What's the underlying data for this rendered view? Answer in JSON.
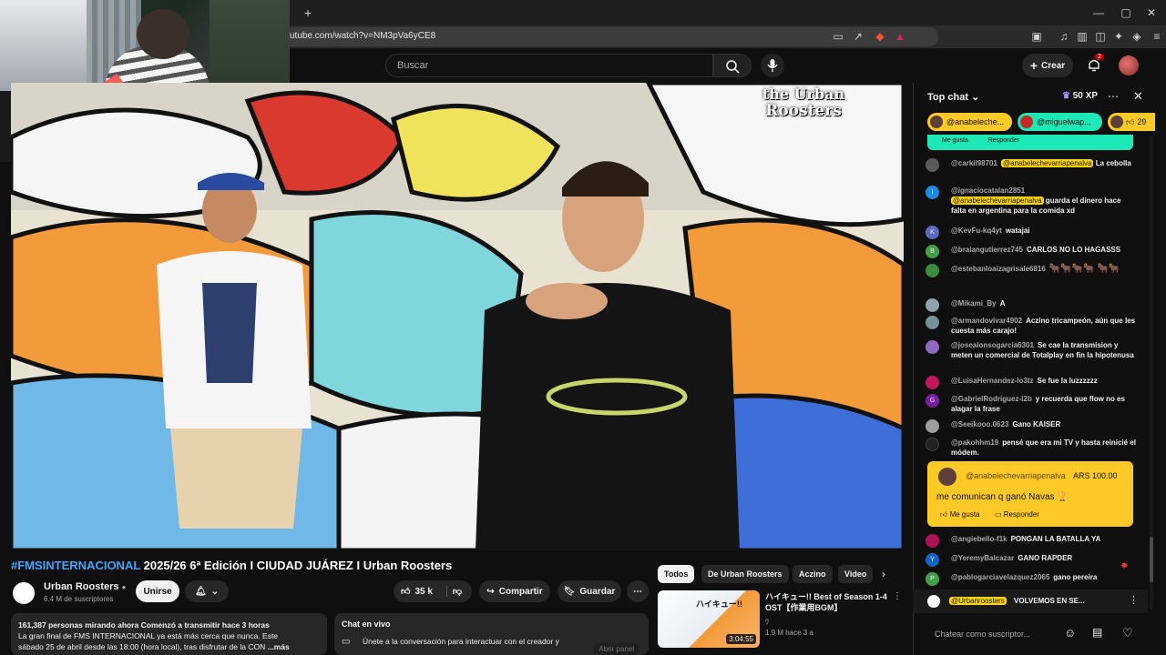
{
  "browser": {
    "url": "utube.com/watch?v=NM3pVa6yCE8",
    "new_tab": "+",
    "window_controls": [
      "minimize-icon",
      "maximize-icon",
      "close-icon"
    ]
  },
  "header": {
    "search_placeholder": "Buscar",
    "create_label": "Crear",
    "notif_count": "2"
  },
  "video": {
    "watermark_line1": "the Urban",
    "watermark_line2": "Roosters",
    "hashtag": "#FMSINTERNACIONAL",
    "title_rest": " 2025/26 6ª Edición I CIUDAD JUÁREZ I Urban Roosters"
  },
  "channel": {
    "name": "Urban Roosters",
    "subs": "6.4 M de suscriptores",
    "join": "Unirse"
  },
  "actions": {
    "likes": "35 k",
    "share": "Compartir",
    "save": "Guardar"
  },
  "description": {
    "line1": "161,387 personas mirando ahora  Comenzó a transmitir hace 3 horas",
    "line2": "La gran final de FMS INTERNACIONAL ya está más cerca que nunca. Este",
    "line3": "sábado 25 de abril desde las 18:00 (hora local), tras disfrutar de la CON",
    "more": "...más"
  },
  "live_chat_card": {
    "title": "Chat en vivo",
    "text": "Únete a la conversación para interactuar con el creador y",
    "button": "Abrir panel"
  },
  "recs": {
    "chips": [
      "Todos",
      "De Urban Roosters",
      "Aczino",
      "Video"
    ],
    "item": {
      "title_line1": "ハイキュー!! Best of Season 1-4",
      "title_line2": "OST【作業用BGM】",
      "channel": "ｳ",
      "meta": "1.9 M   hace 3 a",
      "duration": "3:04:55",
      "thumb_text": "ハイキュー!!"
    }
  },
  "chat": {
    "header": "Top chat",
    "xp": "50 XP",
    "pinned": [
      {
        "name": "@anabeleche..."
      },
      {
        "name": "@miguelwap..."
      },
      {
        "name": "29"
      }
    ],
    "top_actions": {
      "like": "Me gusta",
      "reply": "Responder"
    },
    "messages": [
      {
        "author": "@carkil98701",
        "mention": "@anabelechevarriapenalva",
        "text": "La cebolla",
        "color": "#5b5b5b"
      },
      {
        "author": "@ignaciocatalan2851",
        "mention": "@anabelechevarriapenalva",
        "text": "guarda el dinero hace falta en argentina para la comida xd",
        "color": "#1e88e5",
        "initial": "I"
      },
      {
        "author": "@KevFu-kq4yt",
        "text": "watajai",
        "color": "#5c6bc0",
        "initial": "K"
      },
      {
        "author": "@braiangutierrez745",
        "text": "CARLOS NO LO HAGASSS",
        "color": "#43a047",
        "initial": "B"
      },
      {
        "author": "@estebanloaizagrisale6816",
        "text": "🐂🐂🐂🐂 🐂🐂",
        "color": "#388e3c"
      },
      {
        "author": "@Mikami_By",
        "text": "A",
        "color": "#90a4ae"
      },
      {
        "author": "@armandovivar4902",
        "text": "Aczino tricampeón, aún que les cuesta más carajo!",
        "color": "#78909c"
      },
      {
        "author": "@josealonsogarcia6301",
        "text": "Se cae la transmision y meten un comercial de Totalplay en fin la hipotenusa",
        "color": "#8e6bbf"
      },
      {
        "author": "@LuisaHernandez-lo3tz",
        "text": "Se fue la luzzzzzz",
        "color": "#c2185b"
      },
      {
        "author": "@GabrielRodriguez-l2b",
        "text": "y recuerda que flow no es alagar la frase",
        "color": "#7b1fa2",
        "initial": "G"
      },
      {
        "author": "@Seeikooo.0623",
        "text": "Gano KAISER",
        "color": "#9e9e9e"
      },
      {
        "author": "@pakohhm19",
        "text": "pensé que era mi TV y hasta reinicié el módem.",
        "color": "#212121"
      }
    ],
    "superchat": {
      "author": "@anabelechevarriapenalva",
      "amount": "ARS 100.00",
      "text": "me comunican q ganó Navas 🏆",
      "like": "Me gusta",
      "reply": "Responder"
    },
    "after": [
      {
        "author": "@angiebello-f1k",
        "text": "PONGAN LA BATALLA YA",
        "color": "#ad1457"
      },
      {
        "author": "@YeremyBalcazar",
        "text": "GANO RAPDER",
        "color": "#1565c0",
        "initial": "Y"
      },
      {
        "author": "@pablogarciavelazquez2065",
        "text": "gano pereira",
        "color": "#43a047",
        "initial": "P"
      }
    ],
    "pinned_bottom": {
      "author": "@Urbanroosters",
      "text": "VOLVEMOS EN SE..."
    },
    "input_placeholder": "Chatear como suscriptor..."
  }
}
